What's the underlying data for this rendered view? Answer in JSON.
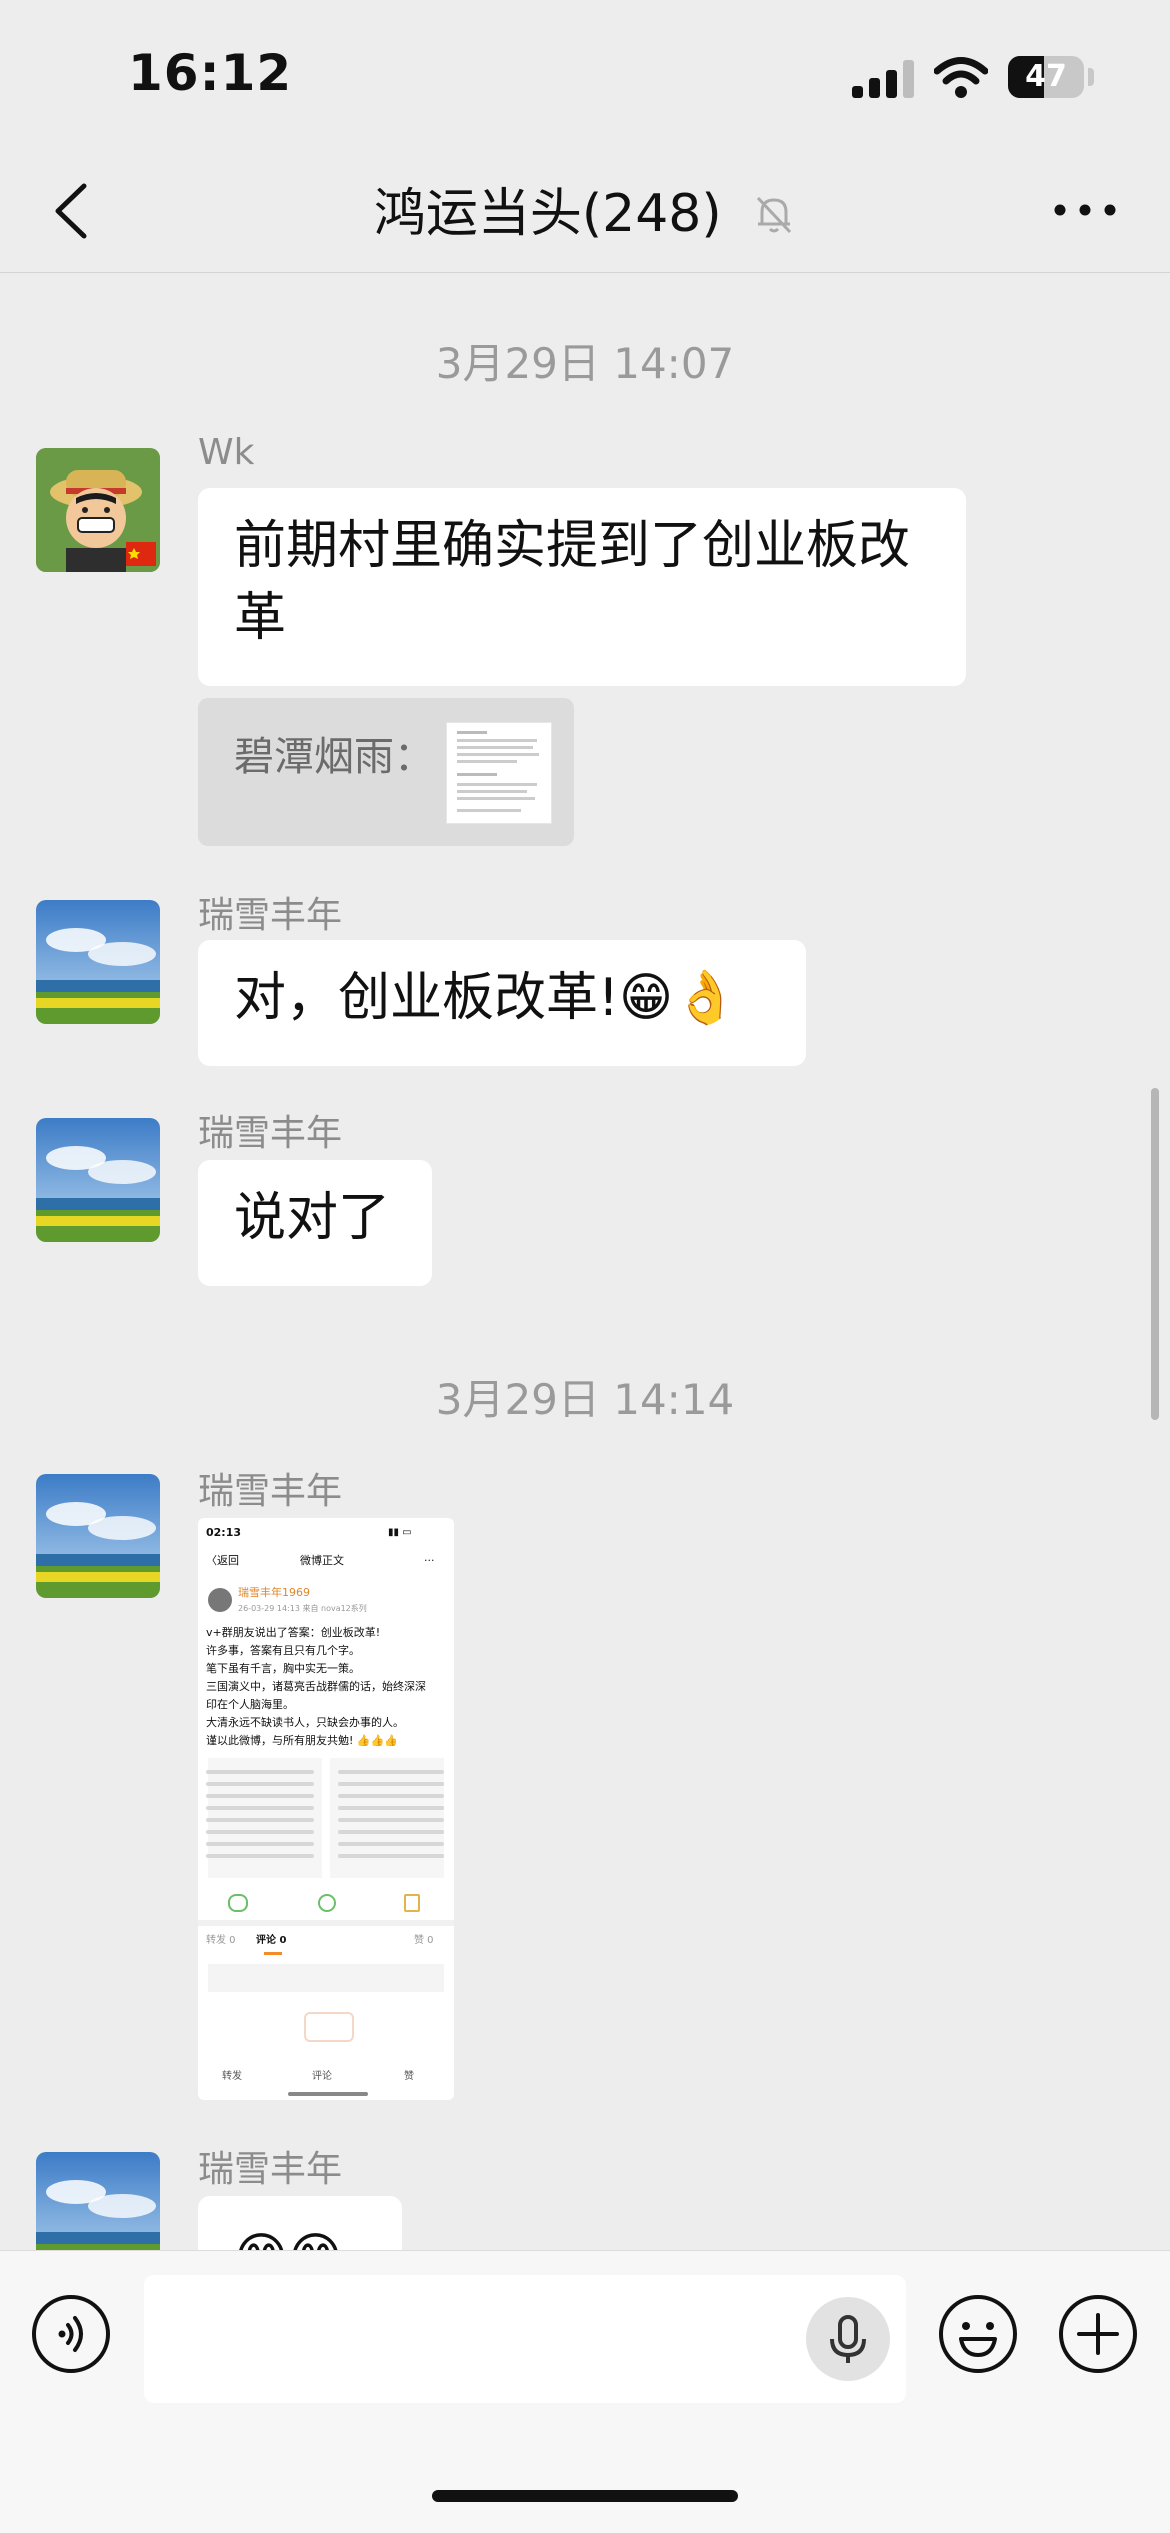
{
  "status_bar": {
    "time": "16:12",
    "battery": "47",
    "battery_level": 0.47
  },
  "header": {
    "title": "鸿运当头",
    "member_count": "(248)"
  },
  "timestamps": [
    "3月29日 14:07",
    "3月29日 14:14"
  ],
  "messages": [
    {
      "sender": "Wk",
      "text": "前期村里确实提到了创业板改\n革",
      "quote": "碧潭烟雨："
    },
    {
      "sender": "瑞雪丰年",
      "text": "对，创业板改革!😁👌"
    },
    {
      "sender": "瑞雪丰年",
      "text": "说对了"
    },
    {
      "sender": "瑞雪丰年",
      "type": "image"
    },
    {
      "sender": "瑞雪丰年",
      "text": "😁😁"
    }
  ],
  "image_preview": {
    "time": "02:13",
    "back": "〈返回",
    "title": "微博正文",
    "author": "瑞雪丰年1969",
    "meta": "26-03-29 14:13 来自 nova12系列",
    "lines": [
      "v+群朋友说出了答案：创业板改革!",
      "许多事，答案有且只有几个字。",
      "笔下虽有千言，胸中实无一策。",
      "三国演义中，诸葛亮舌战群儒的话，始终深深",
      "印在个人脑海里。",
      "大清永远不缺读书人，只缺会办事的人。",
      "谨以此微博，与所有朋友共勉! 👍👍👍"
    ],
    "tabs": [
      "转发 0",
      "评论 0",
      "赞 0"
    ],
    "actions": [
      "转发",
      "评论",
      "赞"
    ]
  }
}
